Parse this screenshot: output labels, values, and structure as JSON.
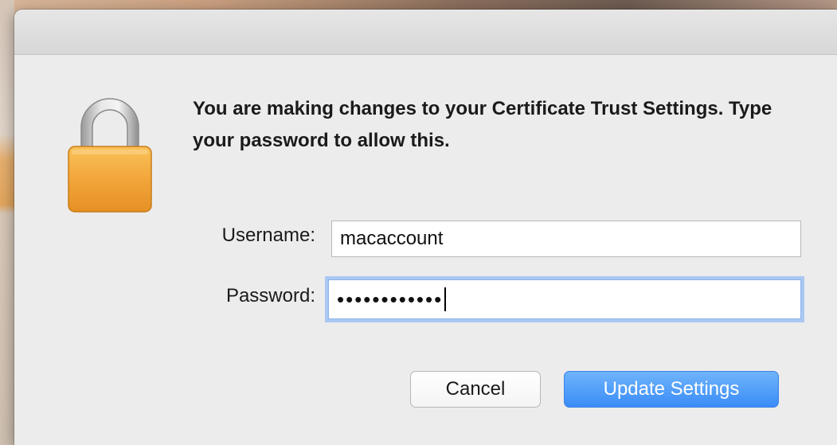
{
  "dialog": {
    "message": "You are making changes to your Certificate Trust Settings. Type your password to allow this.",
    "username_label": "Username:",
    "username_value": "macaccount",
    "password_label": "Password:",
    "password_masked": "••••••••••••",
    "cancel_label": "Cancel",
    "update_label": "Update Settings"
  },
  "icons": {
    "lock": "lock-icon"
  },
  "colors": {
    "lock_body": "#f2a63a",
    "lock_shackle": "#c8c8c8",
    "primary_button": "#3a8cf7",
    "focus_ring": "#a9c8f2"
  }
}
